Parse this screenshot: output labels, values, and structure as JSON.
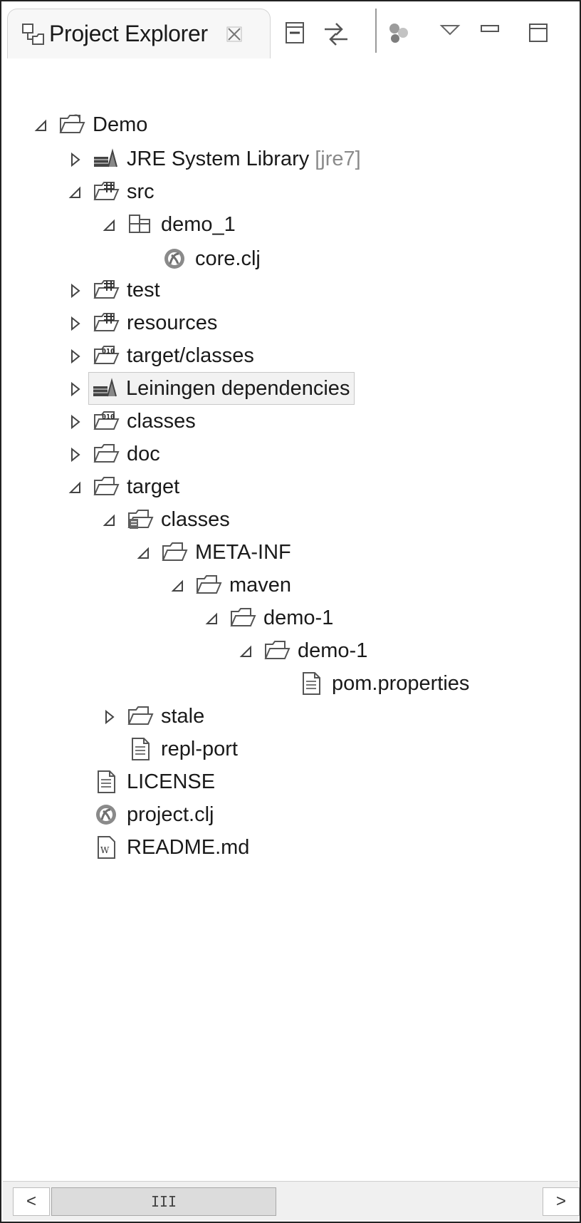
{
  "view": {
    "tab_title": "Project Explorer",
    "tab_icon": "project-explorer-icon",
    "toolbar": [
      {
        "name": "collapse-all-icon"
      },
      {
        "name": "link-with-editor-icon"
      },
      {
        "name": "repl-icon"
      },
      {
        "name": "view-menu-icon"
      },
      {
        "name": "minimize-icon"
      },
      {
        "name": "maximize-icon"
      }
    ]
  },
  "tree": [
    {
      "label": "Demo",
      "icon": "project-folder-icon",
      "twisty": "expanded",
      "depth": 0
    },
    {
      "label": "JRE System Library",
      "decoration": "[jre7]",
      "icon": "library-icon",
      "twisty": "collapsed",
      "depth": 1
    },
    {
      "label": "src",
      "icon": "source-folder-icon",
      "twisty": "expanded",
      "depth": 1
    },
    {
      "label": "demo_1",
      "icon": "package-icon",
      "twisty": "expanded",
      "depth": 2
    },
    {
      "label": "core.clj",
      "icon": "clojure-file-icon",
      "twisty": "none",
      "depth": 3
    },
    {
      "label": "test",
      "icon": "source-folder-icon",
      "twisty": "collapsed",
      "depth": 1
    },
    {
      "label": "resources",
      "icon": "source-folder-icon",
      "twisty": "collapsed",
      "depth": 1
    },
    {
      "label": "target/classes",
      "icon": "class-folder-icon",
      "twisty": "collapsed",
      "depth": 1
    },
    {
      "label": "Leiningen dependencies",
      "icon": "library-icon",
      "twisty": "collapsed",
      "depth": 1,
      "selected": true
    },
    {
      "label": "classes",
      "icon": "class-folder-icon",
      "twisty": "collapsed",
      "depth": 1
    },
    {
      "label": "doc",
      "icon": "folder-icon",
      "twisty": "collapsed",
      "depth": 1
    },
    {
      "label": "target",
      "icon": "folder-icon",
      "twisty": "expanded",
      "depth": 1
    },
    {
      "label": "classes",
      "icon": "output-folder-icon",
      "twisty": "expanded",
      "depth": 2
    },
    {
      "label": "META-INF",
      "icon": "folder-icon",
      "twisty": "expanded",
      "depth": 3
    },
    {
      "label": "maven",
      "icon": "folder-icon",
      "twisty": "expanded",
      "depth": 4
    },
    {
      "label": "demo-1",
      "icon": "folder-icon",
      "twisty": "expanded",
      "depth": 5
    },
    {
      "label": "demo-1",
      "icon": "folder-icon",
      "twisty": "expanded",
      "depth": 6
    },
    {
      "label": "pom.properties",
      "icon": "text-file-icon",
      "twisty": "none",
      "depth": 7
    },
    {
      "label": "stale",
      "icon": "folder-icon",
      "twisty": "collapsed",
      "depth": 2
    },
    {
      "label": "repl-port",
      "icon": "text-file-icon",
      "twisty": "none",
      "depth": 2
    },
    {
      "label": "LICENSE",
      "icon": "text-file-icon",
      "twisty": "none",
      "depth": 1
    },
    {
      "label": "project.clj",
      "icon": "clojure-file-icon",
      "twisty": "none",
      "depth": 1
    },
    {
      "label": "README.md",
      "icon": "wiki-file-icon",
      "twisty": "none",
      "depth": 1
    }
  ],
  "scrollbar": {
    "left_arrow": "<",
    "right_arrow": ">",
    "thumb_grip": "III"
  }
}
